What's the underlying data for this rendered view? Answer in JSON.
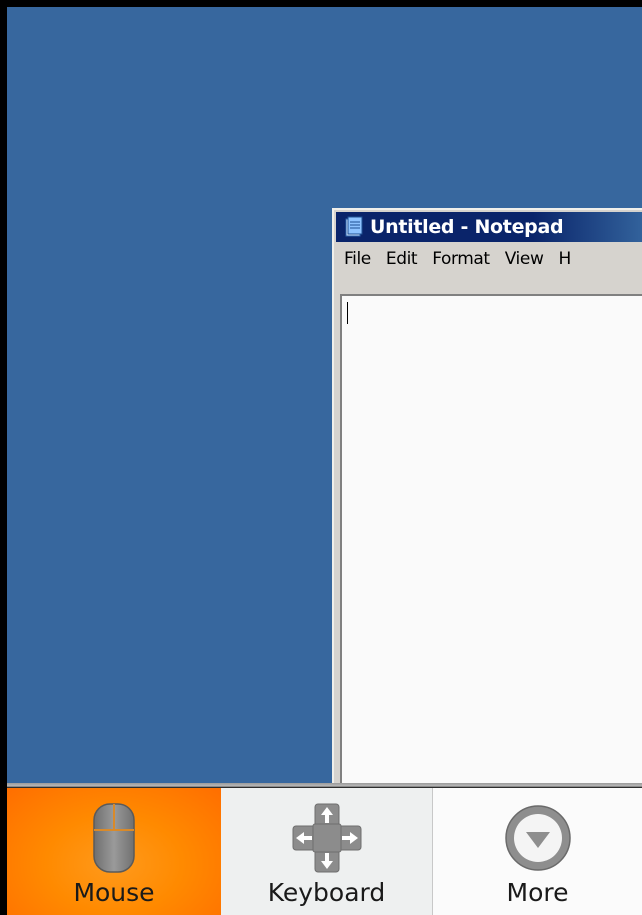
{
  "notepad": {
    "title": "Untitled - Notepad",
    "menu": [
      "File",
      "Edit",
      "Format",
      "View",
      "H"
    ],
    "icon": "notepad-icon"
  },
  "toolbar": {
    "buttons": [
      {
        "label": "Mouse",
        "icon": "mouse-icon",
        "active": true
      },
      {
        "label": "Keyboard",
        "icon": "keyboard-arrows-icon",
        "active": false
      },
      {
        "label": "More",
        "icon": "chevron-down-circle-icon",
        "active": false
      }
    ]
  },
  "colors": {
    "desktop": "#37679e",
    "titlebar": "#0a246a",
    "active_button": "#ff8a00"
  }
}
